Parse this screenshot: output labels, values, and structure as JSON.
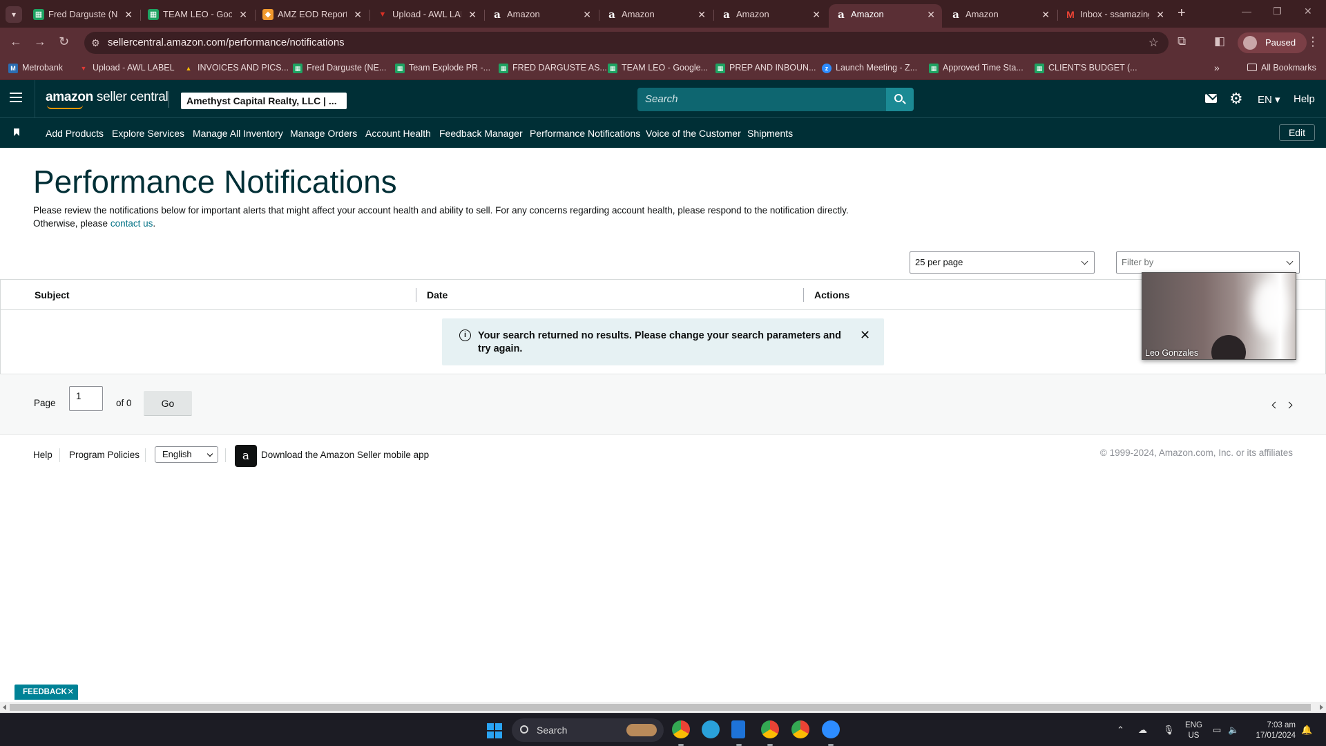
{
  "browser": {
    "tabs": [
      {
        "title": "Fred Darguste (NE",
        "favicon": "sheets-icon"
      },
      {
        "title": "TEAM LEO - Goog",
        "favicon": "sheets-icon"
      },
      {
        "title": "AMZ EOD Report",
        "favicon": "report-icon"
      },
      {
        "title": "Upload - AWL LAB",
        "favicon": "awl-icon"
      },
      {
        "title": "Amazon",
        "favicon": "amazon-icon"
      },
      {
        "title": "Amazon",
        "favicon": "amazon-icon"
      },
      {
        "title": "Amazon",
        "favicon": "amazon-icon"
      },
      {
        "title": "Amazon",
        "favicon": "amazon-icon",
        "active": true
      },
      {
        "title": "Amazon",
        "favicon": "amazon-icon"
      },
      {
        "title": "Inbox - ssamazing",
        "favicon": "gmail-icon"
      }
    ],
    "url": "sellercentral.amazon.com/performance/notifications",
    "profile_label": "Paused",
    "bookmarks": [
      "Metrobank",
      "Upload - AWL LABEL",
      "INVOICES AND PICS...",
      "Fred Darguste (NE...",
      "Team Explode PR -...",
      "FRED DARGUSTE AS...",
      "TEAM LEO - Google...",
      "PREP AND INBOUN...",
      "Launch Meeting - Z...",
      "Approved Time Sta...",
      "CLIENT'S BUDGET (..."
    ],
    "all_bookmarks": "All Bookmarks"
  },
  "header": {
    "logo_bold": "amazon",
    "logo_rest": " seller central",
    "account": "Amethyst Capital Realty, LLC | ...",
    "search_placeholder": "Search",
    "language": "EN",
    "help": "Help"
  },
  "nav": {
    "items": [
      "Add Products",
      "Explore Services",
      "Manage All Inventory",
      "Manage Orders",
      "Account Health",
      "Feedback Manager",
      "Performance Notifications",
      "Voice of the Customer",
      "Shipments"
    ],
    "edit": "Edit"
  },
  "page": {
    "title": "Performance Notifications",
    "intro": "Please review the notifications below for important alerts that might affect your account health and ability to sell. For any concerns regarding account health, please respond to the notification directly. Otherwise, please ",
    "intro_link": "contact us",
    "intro_end": ".",
    "per_page": "25 per page",
    "filter_placeholder": "Filter by",
    "columns": [
      "Subject",
      "Date",
      "Actions"
    ],
    "alert": "Your search returned no results. Please change your search parameters and try again.",
    "video_name": "Leo Gonzales"
  },
  "pager": {
    "page_label": "Page",
    "page_value": "1",
    "of_label": "of 0",
    "go": "Go"
  },
  "footer": {
    "help": "Help",
    "policies": "Program Policies",
    "language": "English",
    "app": "Download the Amazon Seller mobile app",
    "copyright": "© 1999-2024, Amazon.com, Inc. or its affiliates",
    "feedback": "FEEDBACK"
  },
  "taskbar": {
    "search": "Search",
    "lang_top": "ENG",
    "lang_bottom": "US",
    "time": "7:03 am",
    "date": "17/01/2024"
  }
}
